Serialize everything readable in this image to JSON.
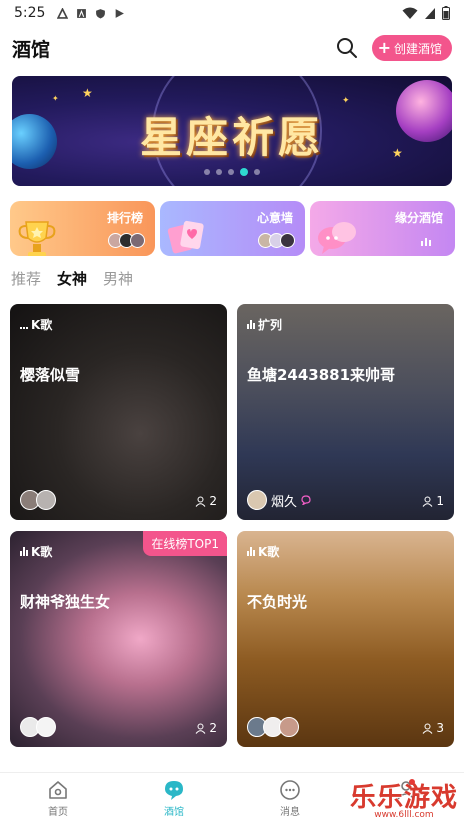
{
  "status_bar": {
    "time": "5:25"
  },
  "header": {
    "title": "酒馆",
    "create_label": "创建酒馆",
    "create_icon": "plus-icon",
    "search_icon": "search-icon"
  },
  "banner": {
    "text": "星座祈愿",
    "dots": 5,
    "active_dot": 4
  },
  "features": [
    {
      "label": "排行榜",
      "icon": "trophy-icon",
      "colors": [
        "#ffc98a",
        "#f9965a"
      ]
    },
    {
      "label": "心意墙",
      "icon": "cards-icon",
      "colors": [
        "#a9b8ff",
        "#b58cf7"
      ]
    },
    {
      "label": "缘分酒馆",
      "icon": "chat-bubble-icon",
      "colors": [
        "#f4a9e8",
        "#c487f2"
      ]
    }
  ],
  "sub_tabs": [
    {
      "label": "推荐",
      "active": false
    },
    {
      "label": "女神",
      "active": true
    },
    {
      "label": "男神",
      "active": false
    }
  ],
  "rooms": [
    {
      "tag": "K歌",
      "title": "樱落似雪",
      "host_name": "",
      "count": "2",
      "badge": ""
    },
    {
      "tag": "扩列",
      "title": "鱼塘2443881来帅哥",
      "host_name": "烟久",
      "count": "1",
      "badge": ""
    },
    {
      "tag": "K歌",
      "title": "财神爷独生女",
      "host_name": "",
      "count": "2",
      "badge": "在线榜TOP1"
    },
    {
      "tag": "K歌",
      "title": "不负时光",
      "host_name": "",
      "count": "3",
      "badge": ""
    }
  ],
  "bottom_nav": [
    {
      "label": "首页",
      "icon": "home-icon",
      "active": false
    },
    {
      "label": "酒馆",
      "icon": "tavern-icon",
      "active": true
    },
    {
      "label": "消息",
      "icon": "message-icon",
      "active": false
    },
    {
      "label": "",
      "icon": "profile-icon",
      "active": false
    }
  ],
  "watermark": {
    "main": "乐乐游戏",
    "sub": "www.6lll.com"
  },
  "colors": {
    "accent": "#f3558c",
    "nav_active": "#2ab7c7"
  }
}
